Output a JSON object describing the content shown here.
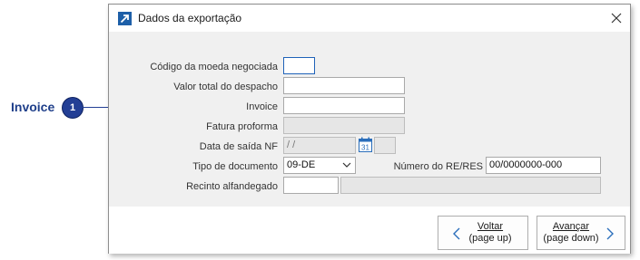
{
  "dialog": {
    "title": "Dados da exportação",
    "icon": "export-arrow-icon",
    "close_icon": "close-icon"
  },
  "form": {
    "moeda": {
      "label": "Código da moeda negociada",
      "value": ""
    },
    "valor_total": {
      "label": "Valor total do despacho",
      "value": ""
    },
    "invoice": {
      "label": "Invoice",
      "value": ""
    },
    "fatura_proforma": {
      "label": "Fatura proforma",
      "value": ""
    },
    "data_saida": {
      "label": "Data de saída NF",
      "value": " /  /",
      "calendar_icon": "calendar-icon",
      "calendar_day": "31",
      "extra_value": ""
    },
    "tipo_documento": {
      "label": "Tipo de documento",
      "value": "09-DE"
    },
    "numero_re": {
      "label": "Número do RE/RES",
      "value": "00/0000000-000"
    },
    "recinto": {
      "label": "Recinto alfandegado",
      "code": "",
      "description": ""
    }
  },
  "footer": {
    "voltar": {
      "line1": "Voltar",
      "line2": "(page up)"
    },
    "avancar": {
      "line1": "Avançar",
      "line2": "(page down)"
    }
  },
  "callout": {
    "label": "Invoice",
    "number": "1",
    "color": "#233f95"
  }
}
